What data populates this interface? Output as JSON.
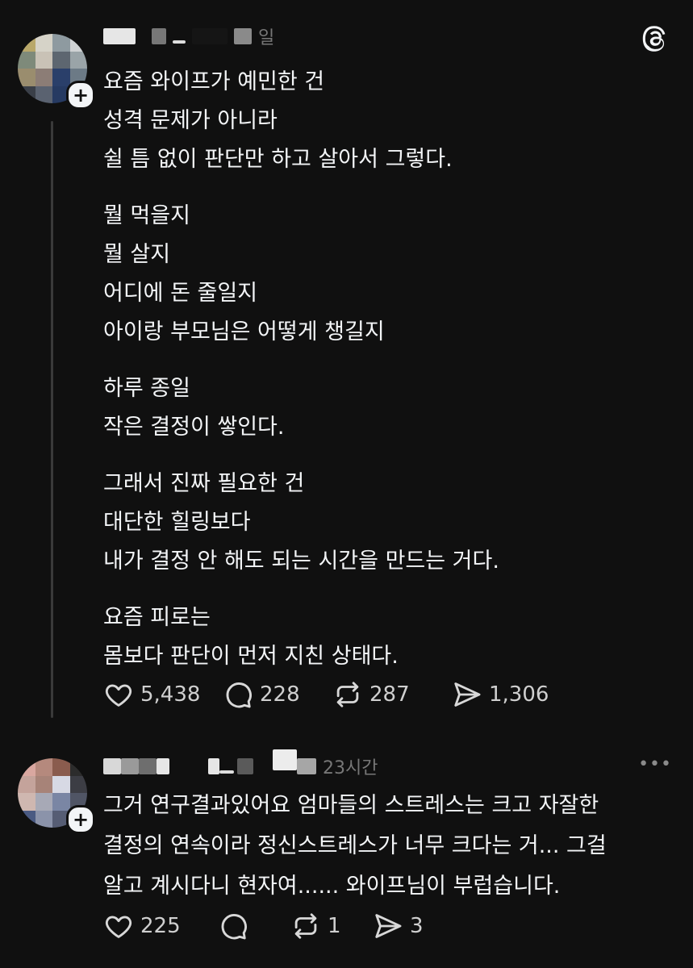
{
  "post": {
    "timestamp_suffix": "일",
    "body": [
      [
        "요즘 와이프가 예민한 건",
        "성격 문제가 아니라",
        "쉴 틈 없이 판단만 하고 살아서 그렇다."
      ],
      [
        "뭘 먹을지",
        "뭘 살지",
        "어디에 돈 줄일지",
        "아이랑 부모님은 어떻게 챙길지"
      ],
      [
        "하루 종일",
        "작은 결정이 쌓인다."
      ],
      [
        "그래서 진짜 필요한 건",
        "대단한 힐링보다",
        "내가 결정 안 해도 되는 시간을 만드는 거다."
      ],
      [
        "요즘 피로는",
        "몸보다 판단이 먼저 지친 상태다."
      ]
    ],
    "actions": {
      "likes": "5,438",
      "comments": "228",
      "reposts": "287",
      "shares": "1,306"
    }
  },
  "reply": {
    "timestamp": "23시간",
    "body": [
      "그거 연구결과있어요 엄마들의 스트레스는 크고 자잘한",
      "결정의 연속이라 정신스트레스가 너무 크다는 거... 그걸",
      "알고 계시다니 현자여...... 와이프님이 부럽습니다."
    ],
    "actions": {
      "likes": "225",
      "comments": "",
      "reposts": "1",
      "shares": "3"
    }
  },
  "icons": {
    "app_logo": "threads-logo-icon",
    "like": "heart-icon",
    "comment": "comment-bubble-icon",
    "repost": "repost-icon",
    "share": "send-icon",
    "more": "more-dots-icon",
    "follow": "plus-icon"
  },
  "colors": {
    "background": "#101010",
    "text": "#f3f5f7",
    "muted": "#777777"
  }
}
